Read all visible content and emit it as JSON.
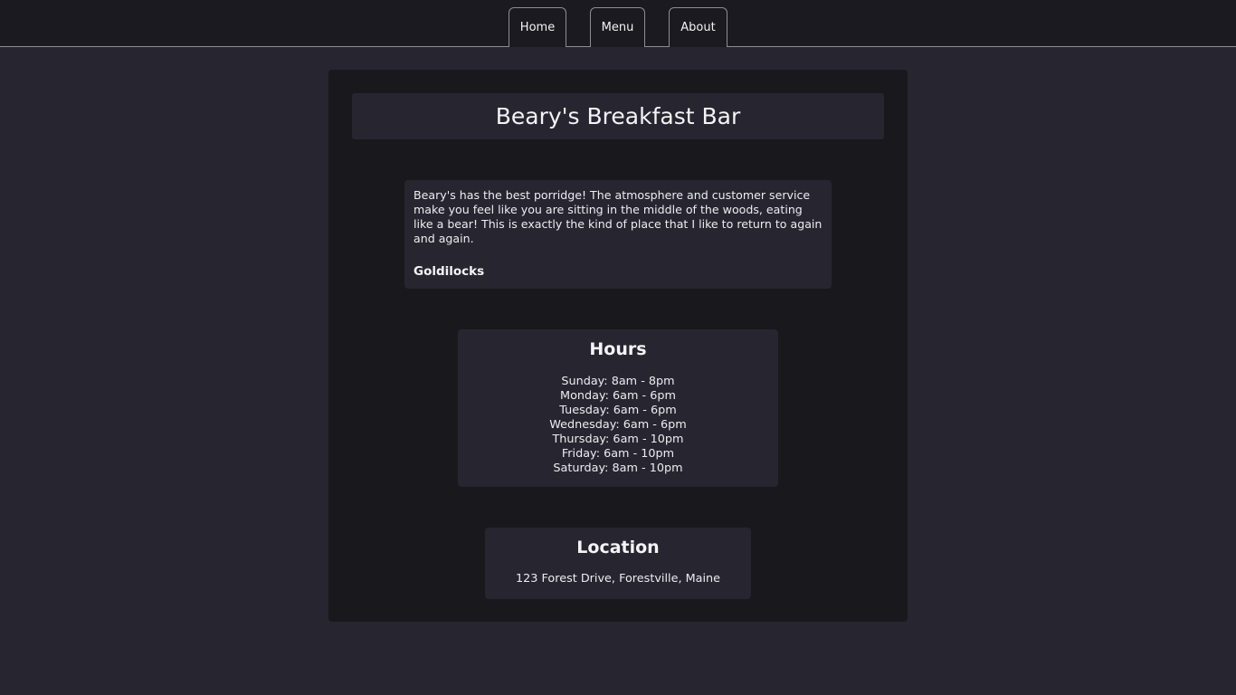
{
  "nav": {
    "items": [
      {
        "label": "Home"
      },
      {
        "label": "Menu"
      },
      {
        "label": "About"
      }
    ]
  },
  "page": {
    "title": "Beary's Breakfast Bar"
  },
  "review": {
    "text": "Beary's has the best porridge! The atmosphere and customer service make you feel like you are sitting in the middle of the woods, eating like a bear! This is exactly the kind of place that I like to return to again and again.",
    "author": "Goldilocks"
  },
  "hours": {
    "heading": "Hours",
    "days": [
      "Sunday: 8am - 8pm",
      "Monday: 6am - 6pm",
      "Tuesday: 6am - 6pm",
      "Wednesday: 6am - 6pm",
      "Thursday: 6am - 10pm",
      "Friday: 6am - 10pm",
      "Saturday: 8am - 10pm"
    ]
  },
  "location": {
    "heading": "Location",
    "address": "123 Forest Drive, Forestville, Maine"
  },
  "colors": {
    "page_background": "#272630",
    "card_background": "#18181d",
    "panel_background": "#272630",
    "nav_border": "#8d8d94",
    "text": "#e9e9ee"
  }
}
